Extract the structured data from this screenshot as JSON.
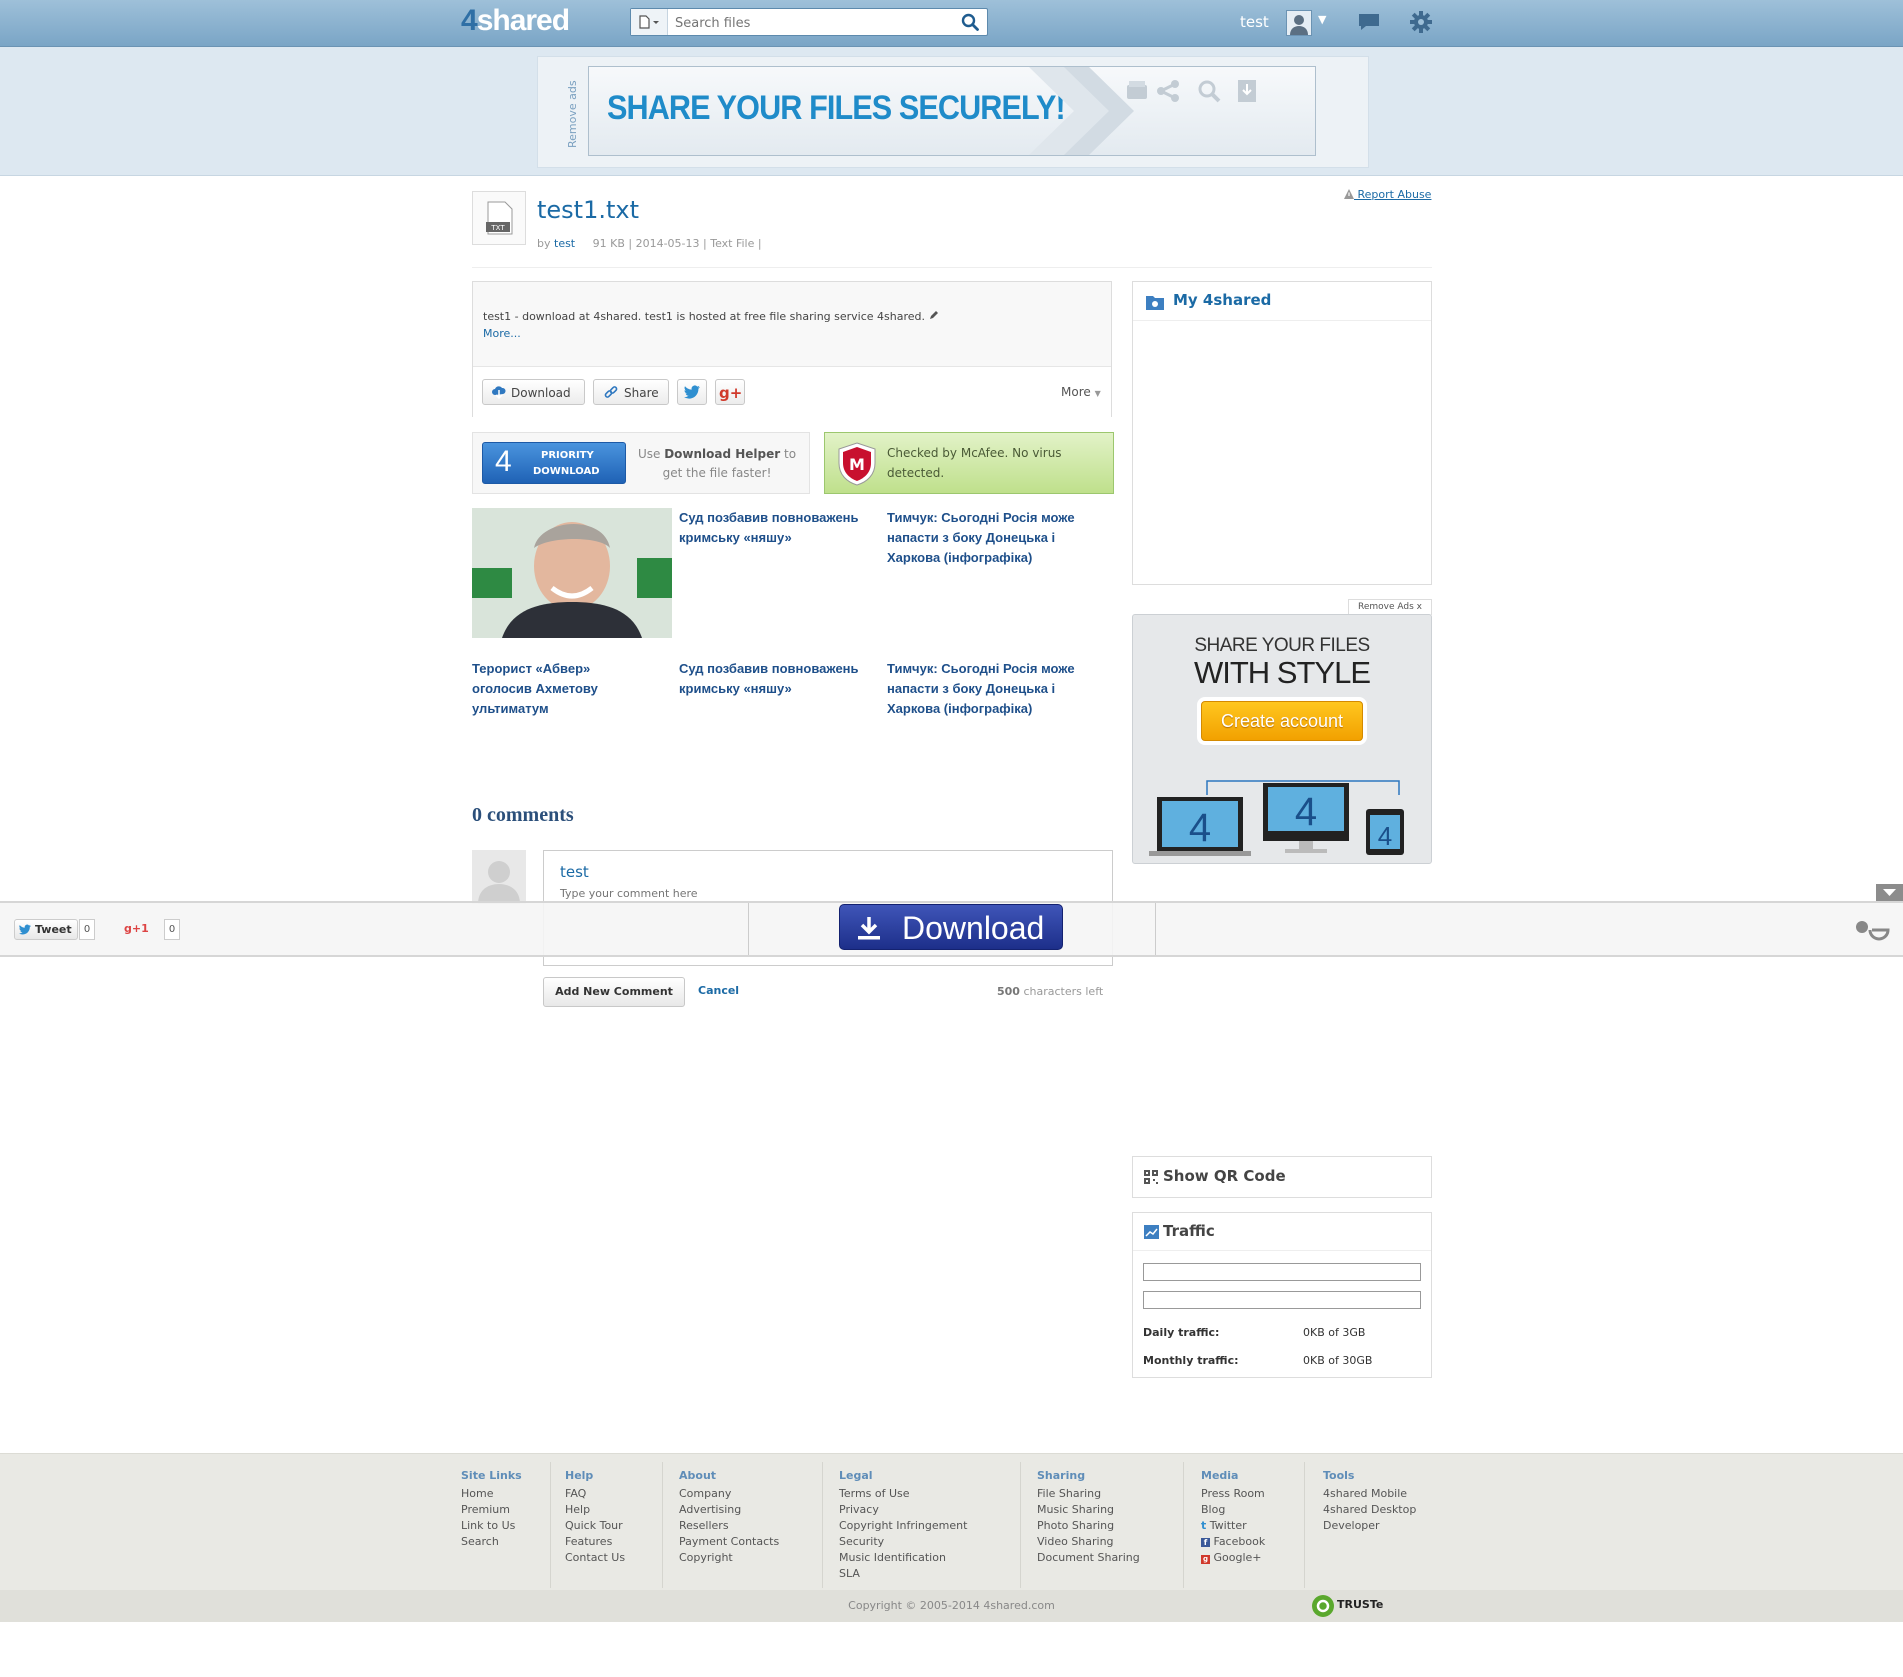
{
  "header": {
    "logo_num": "4",
    "logo_text": "shared",
    "search_placeholder": "Search files",
    "user_name": "test"
  },
  "ad_top": {
    "remove_ads": "Remove ads?",
    "banner_text": "SHARE YOUR FILES SECURELY!"
  },
  "file": {
    "name": "test1.txt",
    "thumb_label": "TXT",
    "by_label": "by",
    "owner": "test",
    "size": "91 KB",
    "date": "2014-05-13",
    "type": "Text File",
    "report_abuse": "Report Abuse",
    "description": "test1 - download at 4shared. test1 is hosted at free file sharing service 4shared.",
    "more_link": "More..."
  },
  "actions": {
    "download": "Download",
    "share": "Share",
    "more": "More"
  },
  "priority": {
    "num": "4",
    "line1": "PRIORITY",
    "line2": "DOWNLOAD",
    "helper_pre": "Use",
    "helper_bold": "Download Helper",
    "helper_post": "to get the file faster!"
  },
  "mcafee": {
    "text": "Checked by McAfee. No virus detected."
  },
  "news": [
    "Суд позбавив повноважень кримську «няшу»",
    "Тимчук: Сьогодні Росія може напасти з боку Донецька і Харкова (інфографіка)",
    "Терорист «Абвер» оголосив Ахметову ультиматум",
    "Суд позбавив повноважень кримську «няшу»",
    "Тимчук: Сьогодні Росія може напасти з боку Донецька і Харкова (інфографіка)"
  ],
  "comments": {
    "title": "0 comments",
    "user": "test",
    "placeholder": "Type your comment here",
    "add_button": "Add New Comment",
    "cancel": "Cancel",
    "chars_count": "500",
    "chars_suffix": "characters left"
  },
  "sticky": {
    "tweet": "Tweet",
    "tweet_count": "0",
    "gplus": "+1",
    "gplus_count": "0",
    "download": "Download"
  },
  "sidebar": {
    "my4shared": "My 4shared",
    "remove_ads": "Remove Ads",
    "style_ad_line1": "SHARE YOUR FILES",
    "style_ad_line2": "WITH STYLE",
    "create_account": "Create account",
    "device_num": "4",
    "qr": "Show QR Code",
    "traffic": "Traffic",
    "daily_label": "Daily traffic:",
    "daily_value": "0KB of 3GB",
    "monthly_label": "Monthly traffic:",
    "monthly_value": "0KB of 30GB"
  },
  "footer": {
    "columns": [
      {
        "head": "Site Links",
        "items": [
          "Home",
          "Premium",
          "Link to Us",
          "Search"
        ]
      },
      {
        "head": "Help",
        "items": [
          "FAQ",
          "Help",
          "Quick Tour",
          "Features",
          "Contact Us"
        ]
      },
      {
        "head": "About",
        "items": [
          "Company",
          "Advertising",
          "Resellers",
          "Payment Contacts",
          "Copyright"
        ]
      },
      {
        "head": "Legal",
        "items": [
          "Terms of Use",
          "Privacy",
          "Copyright Infringement",
          "Security",
          "Music Identification",
          "SLA"
        ]
      },
      {
        "head": "Sharing",
        "items": [
          "File Sharing",
          "Music Sharing",
          "Photo Sharing",
          "Video Sharing",
          "Document Sharing"
        ]
      },
      {
        "head": "Media",
        "items": [
          "Press Room",
          "Blog",
          "Twitter",
          "Facebook",
          "Google+"
        ]
      },
      {
        "head": "Tools",
        "items": [
          "4shared Mobile",
          "4shared Desktop",
          "Developer"
        ]
      }
    ],
    "copyright": "Copyright © 2005-2014 4shared.com",
    "truste": "TRUSTe"
  },
  "colors": {
    "header_bg": "#8fb4d0",
    "link": "#1b6aa5",
    "news": "#1e4f8a",
    "download_btn": "#2a3f9f",
    "create_account": "#f7b20f",
    "mcafee_green": "#c8e59a"
  }
}
